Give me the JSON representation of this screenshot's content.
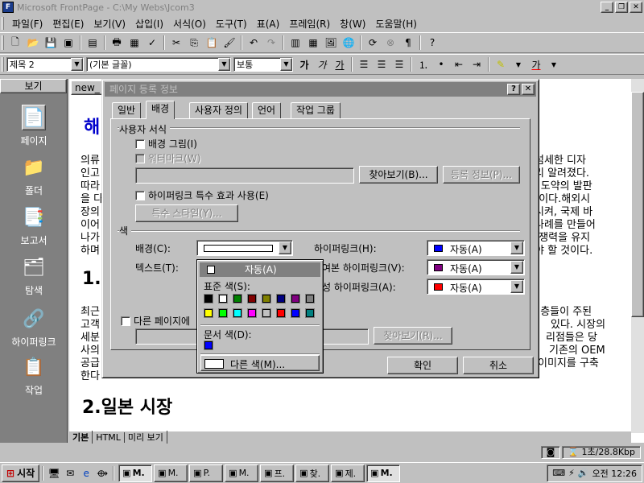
{
  "window": {
    "title": "Microsoft FrontPage - C:\\My Webs\\Jcom3"
  },
  "menu": [
    "파일(F)",
    "편집(E)",
    "보기(V)",
    "삽입(I)",
    "서식(O)",
    "도구(T)",
    "표(A)",
    "프레임(R)",
    "창(W)",
    "도움말(H)"
  ],
  "format_toolbar": {
    "style": "제목 2",
    "font": "(기본 글꼴)",
    "size": "보통",
    "bold": "가",
    "italic": "가",
    "underline": "가",
    "font_color": "가"
  },
  "views": {
    "header": "보기",
    "items": [
      "페이지",
      "폴더",
      "보고서",
      "탐색",
      "하이퍼링크",
      "작업"
    ]
  },
  "document": {
    "tab": "new_",
    "heading1": "해",
    "heading_section1": "1.",
    "heading_section2": "2.일본 시장",
    "left_lines": [
      "의류",
      "인고",
      "따라",
      "을 다",
      "장의",
      "이어",
      "나가",
      "하며"
    ],
    "right_lines": [
      "섬세한 디자",
      "리 알려졌다.",
      "l 도약의 발판",
      "!이다.해외시",
      "시켜, 국제 바",
      "나례를 만들어",
      "!쟁력을 유지",
      "야 할 것이다."
    ],
    "left_lines2": [
      "최근",
      "고객",
      "세분",
      "사의",
      "공급",
      "한다"
    ],
    "right_lines2": [
      "!층들이 주된",
      "있다. 시장의",
      "리점들은 당",
      "기존의 OEM",
      "이미지를 구축"
    ],
    "view_tabs": [
      "기본",
      "HTML",
      "미리 보기"
    ]
  },
  "dialog": {
    "title": "페이지 등록 정보",
    "tabs": [
      "일반",
      "배경",
      "사용자 정의",
      "언어",
      "작업 그룹"
    ],
    "active_tab": "배경",
    "group_user_format": "사용자 서식",
    "chk_background_image": "배경 그림(I)",
    "chk_watermark": "워터마크(W)",
    "btn_browse": "찾아보기(B)...",
    "btn_register": "등록 정보(P)...",
    "chk_hyperlink_effects": "하이퍼링크 특수 효과 사용(E)",
    "btn_special_style": "특수 스타일(Y)...",
    "group_color": "색",
    "lbl_background": "배경(C):",
    "lbl_text": "텍스트(T):",
    "lbl_hyperlink": "하이퍼링크(H):",
    "lbl_visited": "여본 하이퍼링크(V):",
    "lbl_active": "성 하이퍼링크(A):",
    "hyperlink_value": "자동(A)",
    "visited_value": "자동(A)",
    "active_value": "자동(A)",
    "chk_other_page": "다른 페이지에",
    "btn_browse2": "찾아보기(R)...",
    "btn_ok": "확인",
    "btn_cancel": "취소",
    "colors": {
      "hyperlink": "#0000ff",
      "visited": "#800080",
      "active": "#ff0000"
    }
  },
  "color_popup": {
    "auto": "자동(A)",
    "standard_label": "표준 색(S):",
    "standard_colors": [
      "#000000",
      "#ffffff",
      "#008000",
      "#800000",
      "#808000",
      "#000080",
      "#800080",
      "#808080",
      "#ffff00",
      "#00ff00",
      "#00ffff",
      "#ff00ff",
      "#c0c0c0",
      "#ff0000",
      "#0000ff",
      "#008080"
    ],
    "document_label": "문서 색(D):",
    "document_colors": [
      "#0000ff"
    ],
    "other": "다른 색(M)..."
  },
  "statusbar": {
    "transfer": "1초/28.8Kbp"
  },
  "taskbar": {
    "start": "시작",
    "tasks": [
      "M.",
      "M.",
      "P.",
      "M.",
      "프.",
      "찾.",
      "제.",
      "M."
    ],
    "clock": "오전 12:26"
  }
}
